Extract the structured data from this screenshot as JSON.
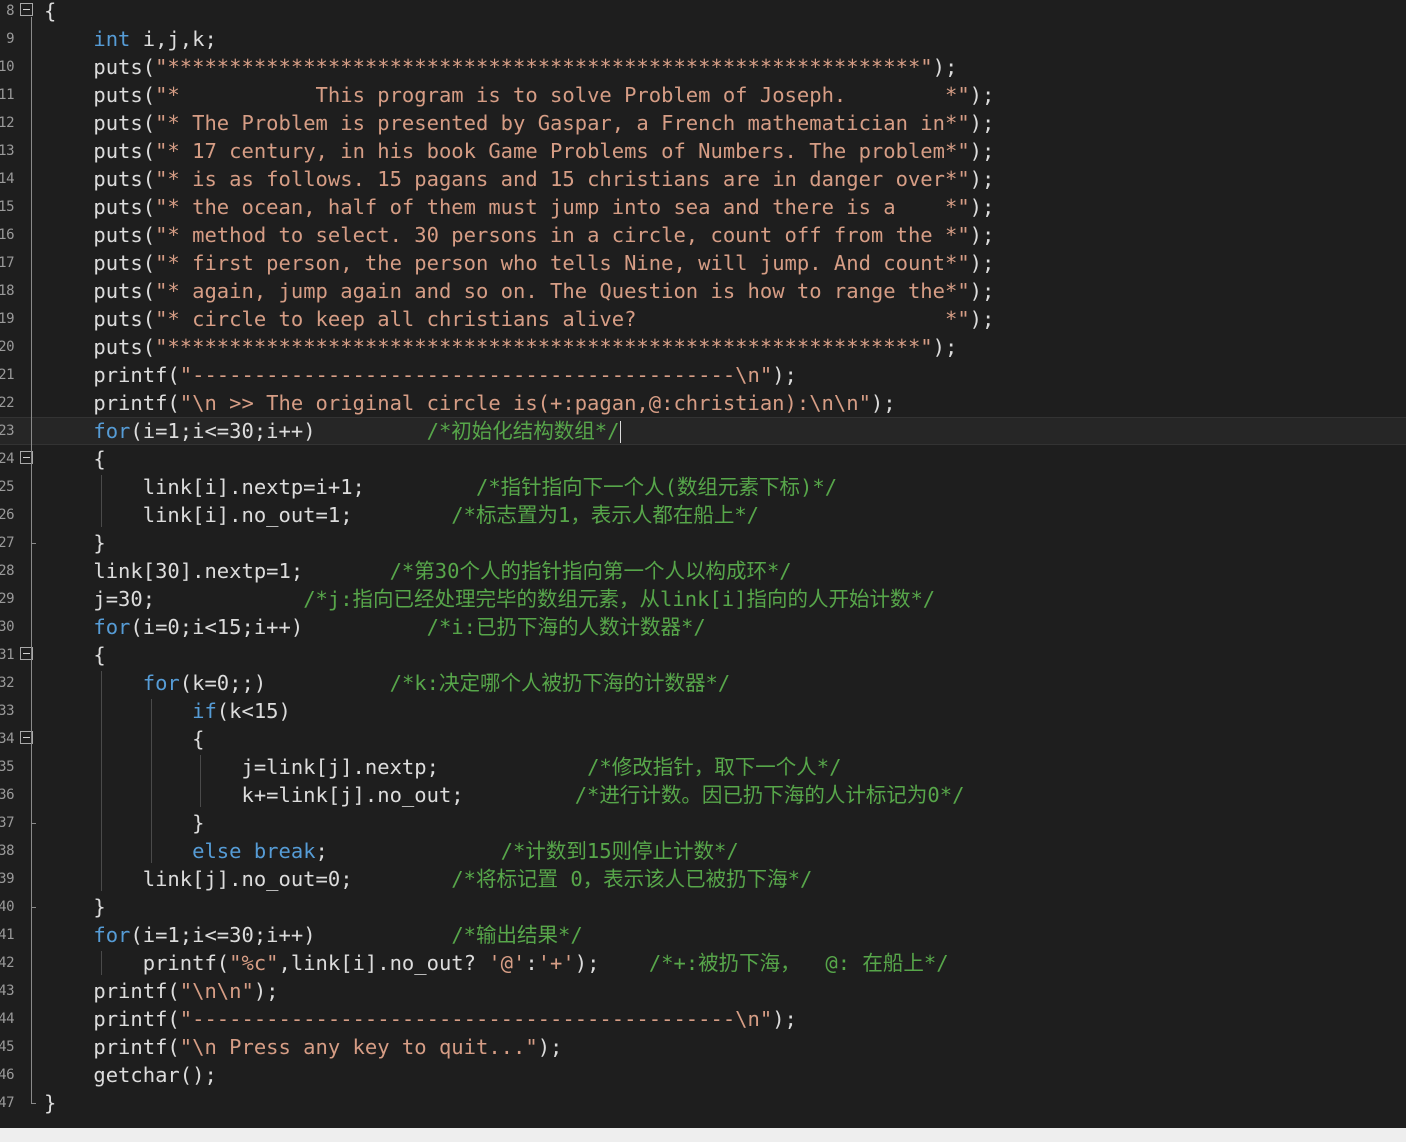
{
  "editor": {
    "colors": {
      "background": "#1e1e1e",
      "keyword": "#569cd6",
      "string": "#d69d85",
      "comment": "#57a64a",
      "number": "#b5cea8",
      "identifier": "#dcdcdc",
      "line_number": "#9a9a9a"
    },
    "icons": {
      "fold": "collapse-minus-icon"
    },
    "lines": [
      {
        "n": "8",
        "fold": true,
        "tokens": [
          [
            "p",
            "{"
          ]
        ]
      },
      {
        "n": "9",
        "tokens": [
          [
            "t",
            "    "
          ],
          [
            "k",
            "int"
          ],
          [
            "t",
            " i,j,k;"
          ]
        ]
      },
      {
        "n": "10",
        "tokens": [
          [
            "t",
            "    puts("
          ],
          [
            "s",
            "\"*************************************************************\""
          ],
          [
            "t",
            ");"
          ]
        ]
      },
      {
        "n": "11",
        "tokens": [
          [
            "t",
            "    puts("
          ],
          [
            "s",
            "\"*           This program is to solve Problem of Joseph.        *\""
          ],
          [
            "t",
            ");"
          ]
        ]
      },
      {
        "n": "12",
        "tokens": [
          [
            "t",
            "    puts("
          ],
          [
            "s",
            "\"* The Problem is presented by Gaspar, a French mathematician in*\""
          ],
          [
            "t",
            ");"
          ]
        ]
      },
      {
        "n": "13",
        "tokens": [
          [
            "t",
            "    puts("
          ],
          [
            "s",
            "\"* 17 century, in his book Game Problems of Numbers. The problem*\""
          ],
          [
            "t",
            ");"
          ]
        ]
      },
      {
        "n": "14",
        "tokens": [
          [
            "t",
            "    puts("
          ],
          [
            "s",
            "\"* is as follows. 15 pagans and 15 christians are in danger over*\""
          ],
          [
            "t",
            ");"
          ]
        ]
      },
      {
        "n": "15",
        "tokens": [
          [
            "t",
            "    puts("
          ],
          [
            "s",
            "\"* the ocean, half of them must jump into sea and there is a    *\""
          ],
          [
            "t",
            ");"
          ]
        ]
      },
      {
        "n": "16",
        "tokens": [
          [
            "t",
            "    puts("
          ],
          [
            "s",
            "\"* method to select. 30 persons in a circle, count off from the *\""
          ],
          [
            "t",
            ");"
          ]
        ]
      },
      {
        "n": "17",
        "tokens": [
          [
            "t",
            "    puts("
          ],
          [
            "s",
            "\"* first person, the person who tells Nine, will jump. And count*\""
          ],
          [
            "t",
            ");"
          ]
        ]
      },
      {
        "n": "18",
        "tokens": [
          [
            "t",
            "    puts("
          ],
          [
            "s",
            "\"* again, jump again and so on. The Question is how to range the*\""
          ],
          [
            "t",
            ");"
          ]
        ]
      },
      {
        "n": "19",
        "tokens": [
          [
            "t",
            "    puts("
          ],
          [
            "s",
            "\"* circle to keep all christians alive?                         *\""
          ],
          [
            "t",
            ");"
          ]
        ]
      },
      {
        "n": "20",
        "tokens": [
          [
            "t",
            "    puts("
          ],
          [
            "s",
            "\"*************************************************************\""
          ],
          [
            "t",
            ");"
          ]
        ]
      },
      {
        "n": "21",
        "tokens": [
          [
            "t",
            "    printf("
          ],
          [
            "s",
            "\"--------------------------------------------\\n\""
          ],
          [
            "t",
            ");"
          ]
        ]
      },
      {
        "n": "22",
        "tokens": [
          [
            "t",
            "    printf("
          ],
          [
            "s",
            "\"\\n >> The original circle is(+:pagan,@:christian):\\n\\n\""
          ],
          [
            "t",
            ");"
          ]
        ]
      },
      {
        "n": "23",
        "current": true,
        "tokens": [
          [
            "t",
            "    "
          ],
          [
            "k",
            "for"
          ],
          [
            "t",
            "(i=1;i<=30;i++)         "
          ],
          [
            "c",
            "/*初始化结构数组*/"
          ],
          [
            "caret",
            ""
          ]
        ]
      },
      {
        "n": "24",
        "fold": true,
        "tokens": [
          [
            "t",
            "    "
          ],
          [
            "p",
            "{"
          ]
        ]
      },
      {
        "n": "25",
        "tokens": [
          [
            "t",
            "        link[i].nextp=i+1;         "
          ],
          [
            "c",
            "/*指针指向下一个人(数组元素下标)*/"
          ]
        ]
      },
      {
        "n": "26",
        "tokens": [
          [
            "t",
            "        link[i].no_out=1;        "
          ],
          [
            "c",
            "/*标志置为1，表示人都在船上*/"
          ]
        ]
      },
      {
        "n": "27",
        "tokens": [
          [
            "t",
            "    "
          ],
          [
            "p",
            "}"
          ]
        ]
      },
      {
        "n": "28",
        "tokens": [
          [
            "t",
            "    link[30].nextp=1;       "
          ],
          [
            "c",
            "/*第30个人的指针指向第一个人以构成环*/"
          ]
        ]
      },
      {
        "n": "29",
        "tokens": [
          [
            "t",
            "    j=30;            "
          ],
          [
            "c",
            "/*j:指向已经处理完毕的数组元素，从link[i]指向的人开始计数*/"
          ]
        ]
      },
      {
        "n": "30",
        "tokens": [
          [
            "t",
            "    "
          ],
          [
            "k",
            "for"
          ],
          [
            "t",
            "(i=0;i<15;i++)          "
          ],
          [
            "c",
            "/*i:已扔下海的人数计数器*/"
          ]
        ]
      },
      {
        "n": "31",
        "fold": true,
        "tokens": [
          [
            "t",
            "    "
          ],
          [
            "p",
            "{"
          ]
        ]
      },
      {
        "n": "32",
        "tokens": [
          [
            "t",
            "        "
          ],
          [
            "k",
            "for"
          ],
          [
            "t",
            "(k=0;;)          "
          ],
          [
            "c",
            "/*k:决定哪个人被扔下海的计数器*/"
          ]
        ]
      },
      {
        "n": "33",
        "tokens": [
          [
            "t",
            "            "
          ],
          [
            "k",
            "if"
          ],
          [
            "t",
            "(k<15)"
          ]
        ]
      },
      {
        "n": "34",
        "fold": true,
        "tokens": [
          [
            "t",
            "            "
          ],
          [
            "p",
            "{"
          ]
        ]
      },
      {
        "n": "35",
        "tokens": [
          [
            "t",
            "                j=link[j].nextp;            "
          ],
          [
            "c",
            "/*修改指针，取下一个人*/"
          ]
        ]
      },
      {
        "n": "36",
        "tokens": [
          [
            "t",
            "                k+=link[j].no_out;         "
          ],
          [
            "c",
            "/*进行计数。因已扔下海的人计标记为0*/"
          ]
        ]
      },
      {
        "n": "37",
        "tokens": [
          [
            "t",
            "            "
          ],
          [
            "p",
            "}"
          ]
        ]
      },
      {
        "n": "38",
        "tokens": [
          [
            "t",
            "            "
          ],
          [
            "k",
            "else break"
          ],
          [
            "t",
            ";              "
          ],
          [
            "c",
            "/*计数到15则停止计数*/"
          ]
        ]
      },
      {
        "n": "39",
        "tokens": [
          [
            "t",
            "        link[j].no_out=0;        "
          ],
          [
            "c",
            "/*将标记置 0，表示该人已被扔下海*/"
          ]
        ]
      },
      {
        "n": "40",
        "tokens": [
          [
            "t",
            "    "
          ],
          [
            "p",
            "}"
          ]
        ]
      },
      {
        "n": "41",
        "tokens": [
          [
            "t",
            "    "
          ],
          [
            "k",
            "for"
          ],
          [
            "t",
            "(i=1;i<=30;i++)           "
          ],
          [
            "c",
            "/*输出结果*/"
          ]
        ]
      },
      {
        "n": "42",
        "tokens": [
          [
            "t",
            "        printf("
          ],
          [
            "s",
            "\"%c\""
          ],
          [
            "t",
            ",link[i].no_out? "
          ],
          [
            "s",
            "'@'"
          ],
          [
            "t",
            ":"
          ],
          [
            "s",
            "'+'"
          ],
          [
            "t",
            ");    "
          ],
          [
            "c",
            "/*+:被扔下海，  @: 在船上*/"
          ]
        ]
      },
      {
        "n": "43",
        "tokens": [
          [
            "t",
            "    printf("
          ],
          [
            "s",
            "\"\\n\\n\""
          ],
          [
            "t",
            ");"
          ]
        ]
      },
      {
        "n": "44",
        "tokens": [
          [
            "t",
            "    printf("
          ],
          [
            "s",
            "\"--------------------------------------------\\n\""
          ],
          [
            "t",
            ");"
          ]
        ]
      },
      {
        "n": "45",
        "tokens": [
          [
            "t",
            "    printf("
          ],
          [
            "s",
            "\"\\n Press any key to quit...\""
          ],
          [
            "t",
            ");"
          ]
        ]
      },
      {
        "n": "46",
        "tokens": [
          [
            "t",
            "    getchar();"
          ]
        ]
      },
      {
        "n": "47",
        "tokens": [
          [
            "p",
            "}"
          ]
        ]
      }
    ]
  }
}
